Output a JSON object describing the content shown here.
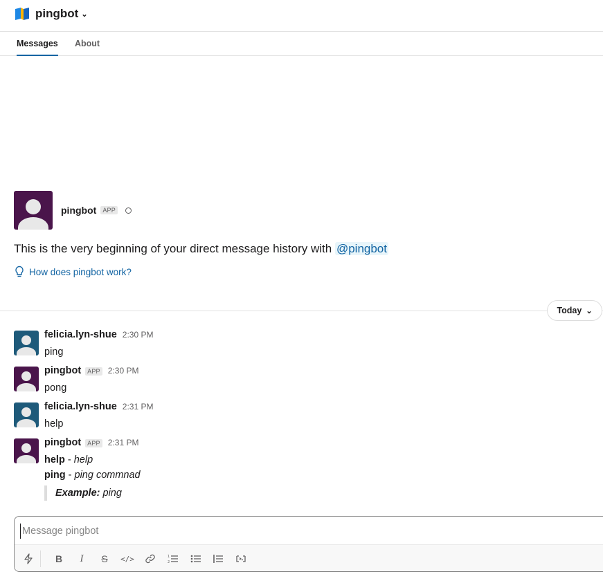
{
  "header": {
    "title": "pingbot"
  },
  "tabs": [
    {
      "label": "Messages"
    },
    {
      "label": "About"
    }
  ],
  "intro": {
    "name": "pingbot",
    "badge": "APP",
    "text": "This is the very beginning of your direct message history with",
    "mention": "@pingbot",
    "help_link": "How does pingbot work?"
  },
  "divider": {
    "label": "Today"
  },
  "messages": [
    {
      "sender": "felicia.lyn-shue",
      "time": "2:30 PM",
      "text": "ping"
    },
    {
      "sender": "pingbot",
      "badge": "APP",
      "time": "2:30 PM",
      "text": "pong"
    },
    {
      "sender": "felicia.lyn-shue",
      "time": "2:31 PM",
      "text": "help"
    },
    {
      "sender": "pingbot",
      "badge": "APP",
      "time": "2:31 PM",
      "lines": [
        {
          "cmd": "help",
          "sep": "-",
          "desc": "help"
        },
        {
          "cmd": "ping",
          "sep": "-",
          "desc": "ping commnad"
        }
      ],
      "example_label": "Example:",
      "example_value": "ping"
    }
  ],
  "composer": {
    "placeholder": "Message pingbot"
  },
  "colors": {
    "accent": "#1264a3",
    "bot_avatar": "#4a154b",
    "user_avatar": "#1e5a7a"
  }
}
